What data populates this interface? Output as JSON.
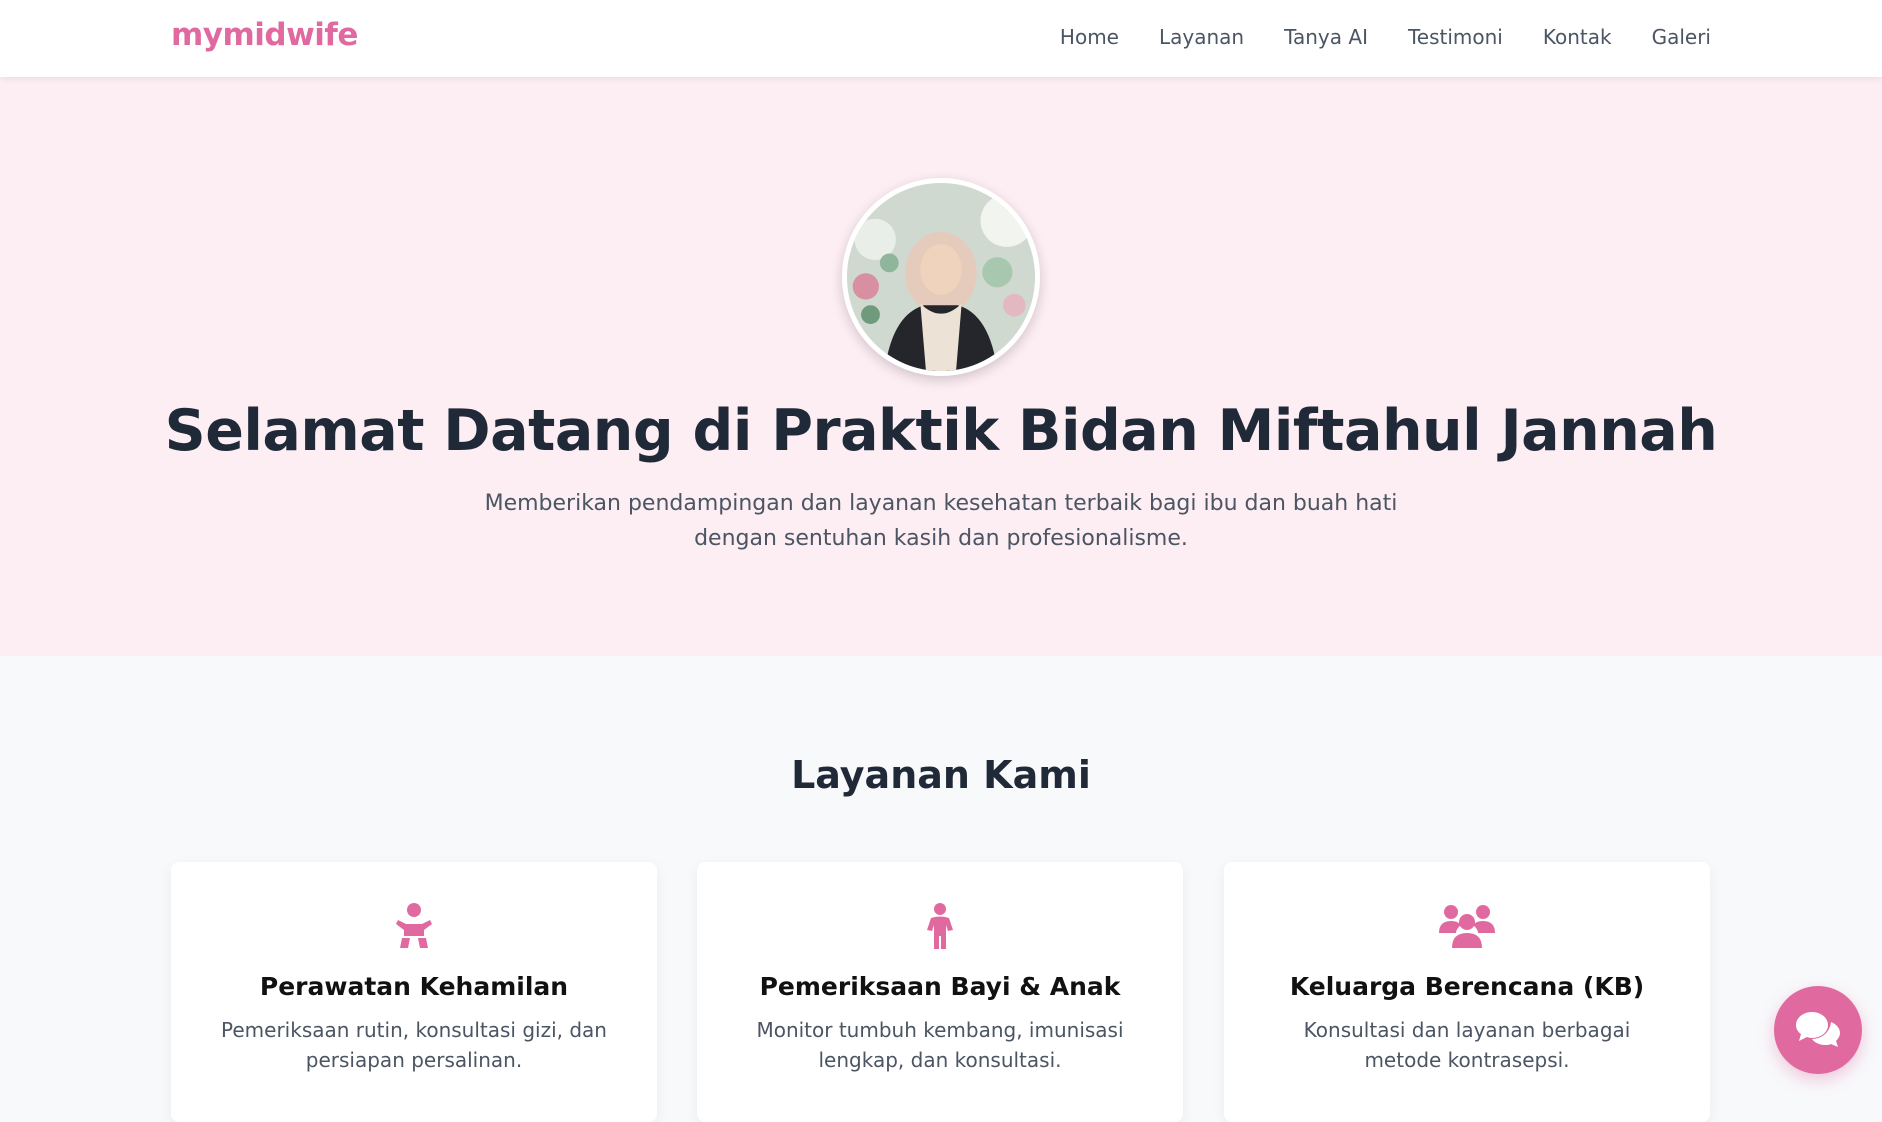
{
  "brand": {
    "logo": "mymidwife",
    "accent_color": "#e06aa0"
  },
  "nav": {
    "items": [
      {
        "label": "Home"
      },
      {
        "label": "Layanan"
      },
      {
        "label": "Tanya AI"
      },
      {
        "label": "Testimoni"
      },
      {
        "label": "Kontak"
      },
      {
        "label": "Galeri"
      }
    ]
  },
  "hero": {
    "title": "Selamat Datang di Praktik Bidan Miftahul Jannah",
    "subtitle": "Memberikan pendampingan dan layanan kesehatan terbaik bagi ibu dan buah hati dengan sentuhan kasih dan profesionalisme.",
    "background_color": "#fdeef3"
  },
  "services": {
    "title": "Layanan Kami",
    "cards": [
      {
        "icon": "baby-icon",
        "title": "Perawatan Kehamilan",
        "description": "Pemeriksaan rutin, konsultasi gizi, dan persiapan persalinan."
      },
      {
        "icon": "child-icon",
        "title": "Pemeriksaan Bayi & Anak",
        "description": "Monitor tumbuh kembang, imunisasi lengkap, dan konsultasi."
      },
      {
        "icon": "family-icon",
        "title": "Keluarga Berencana (KB)",
        "description": "Konsultasi dan layanan berbagai metode kontrasepsi."
      }
    ]
  },
  "chat": {
    "icon": "chat-bubbles-icon"
  }
}
